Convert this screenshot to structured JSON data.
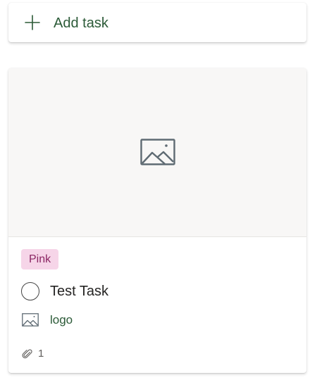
{
  "add_task": {
    "label": "Add task",
    "icon": "plus-icon"
  },
  "task_card": {
    "preview_icon": "image-placeholder-icon",
    "label": {
      "text": "Pink",
      "background_color": "#f6d5e8",
      "text_color": "#8b2563"
    },
    "title": "Test Task",
    "attachment": {
      "icon": "file-image-icon",
      "name": "logo"
    },
    "footer": {
      "icon": "paperclip-icon",
      "attachment_count": "1"
    }
  },
  "colors": {
    "accent": "#2b5a37",
    "text": "#252423",
    "muted": "#605e5c",
    "preview_background": "#f8f7f6"
  }
}
